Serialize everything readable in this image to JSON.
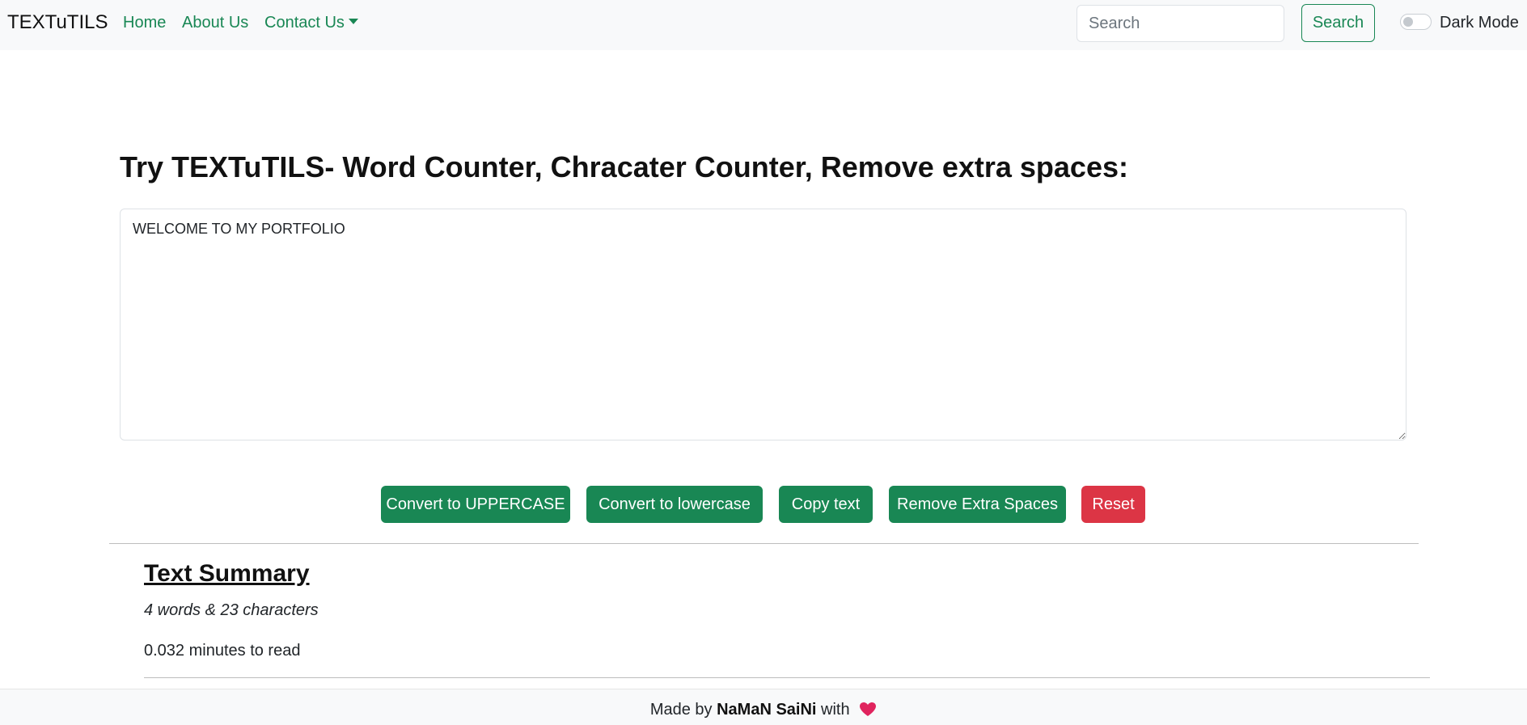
{
  "nav": {
    "brand": "TEXTuTILS",
    "links": {
      "home": "Home",
      "about": "About Us",
      "contact": "Contact Us"
    },
    "search_placeholder": "Search",
    "search_button": "Search",
    "dark_mode_label": "Dark Mode",
    "dark_mode_on": false
  },
  "main": {
    "heading": "Try TEXTuTILS- Word Counter, Chracater Counter, Remove extra spaces:",
    "textarea_value": "WELCOME TO MY PORTFOLIO",
    "buttons": {
      "uppercase": "Convert to UPPERCASE",
      "lowercase": "Convert to lowercase",
      "copy": "Copy text",
      "remove_spaces": "Remove Extra Spaces",
      "reset": "Reset"
    }
  },
  "summary": {
    "title": "Text Summary",
    "counts": "4 words & 23 characters",
    "read_time": "0.032 minutes to read"
  },
  "footer": {
    "prefix": "Made by",
    "author": "NaMaN SaiNi",
    "suffix": "with",
    "heart_icon": "heart-icon"
  },
  "colors": {
    "accent_green": "#198754",
    "danger_red": "#dc3545",
    "heart": "#e0245e"
  }
}
